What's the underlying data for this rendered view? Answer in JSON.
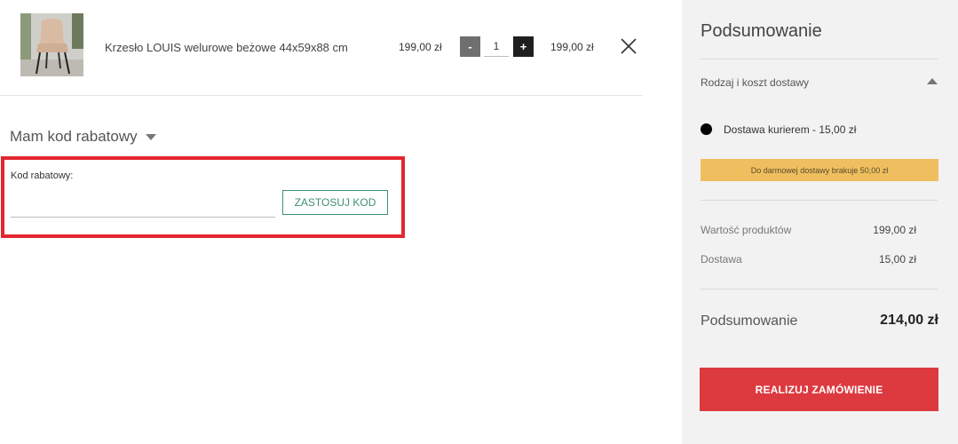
{
  "cart": {
    "item": {
      "image_icon": "chair-photo",
      "name": "Krzesło LOUIS welurowe beżowe 44x59x88 cm",
      "unit_price": "199,00 zł",
      "qty_minus_label": "-",
      "qty_value": "1",
      "qty_plus_label": "+",
      "line_total": "199,00 zł",
      "remove_icon": "close-icon"
    }
  },
  "coupon": {
    "toggle_label": "Mam kod rabatowy",
    "field_label": "Kod rabatowy:",
    "input_value": "",
    "apply_label": "ZASTOSUJ KOD",
    "highlight_color": "#e3262f"
  },
  "summary": {
    "title": "Podsumowanie",
    "delivery_header": "Rodzaj i koszt dostawy",
    "delivery_option": "Dostawa kurierem  - 15,00 zł",
    "delivery_selected": true,
    "free_shipping_notice": "Do darmowej dostawy brakuje 50,00 zł",
    "rows": [
      {
        "label": "Wartość produktów",
        "value": "199,00 zł"
      },
      {
        "label": "Dostawa",
        "value": "15,00 zł"
      }
    ],
    "total_label": "Podsumowanie",
    "total_value": "214,00 zł",
    "order_button": "REALIZUJ ZAMÓWIENIE",
    "order_button_color": "#dc3a3f",
    "notice_color": "#efbf5f",
    "accent_color": "#3f8f7a"
  }
}
